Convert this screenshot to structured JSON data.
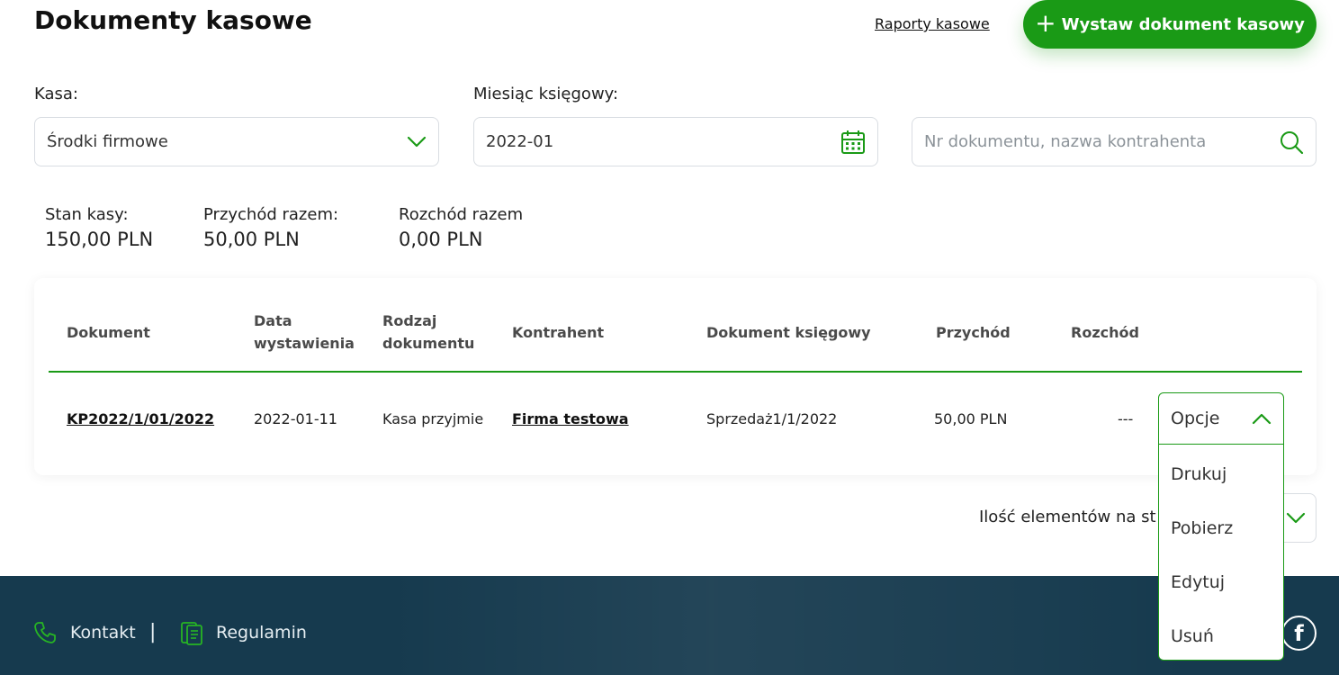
{
  "header": {
    "title": "Dokumenty kasowe",
    "reports_link": "Raporty kasowe",
    "primary_button": "Wystaw dokument kasowy"
  },
  "filters": {
    "kasa": {
      "label": "Kasa:",
      "value": "Środki firmowe"
    },
    "month": {
      "label": "Miesiąc księgowy:",
      "value": "2022-01"
    },
    "search": {
      "placeholder": "Nr dokumentu, nazwa kontrahenta"
    }
  },
  "summary": [
    {
      "label": "Stan kasy:",
      "value": "150,00 PLN"
    },
    {
      "label": "Przychód razem:",
      "value": "50,00 PLN"
    },
    {
      "label": "Rozchód razem",
      "value": "0,00 PLN"
    }
  ],
  "table": {
    "columns": [
      "Dokument",
      "Data wystawienia",
      "Rodzaj dokumentu",
      "Kontrahent",
      "Dokument księgowy",
      "Przychód",
      "Rozchód"
    ],
    "rows": [
      {
        "dokument": "KP2022/1/01/2022",
        "data": "2022-01-11",
        "rodzaj": "Kasa przyjmie",
        "kontrahent": "Firma testowa",
        "dokument_ksiegowy": "Sprzedaż1/1/2022",
        "przychod": "50,00 PLN",
        "rozchod": "---"
      }
    ]
  },
  "options_menu": {
    "label": "Opcje",
    "items": [
      "Drukuj",
      "Pobierz",
      "Edytuj",
      "Usuń"
    ]
  },
  "pagination": {
    "per_page_label": "Ilość elementów na st"
  },
  "footer": {
    "links": [
      "Kontakt",
      "Regulamin"
    ],
    "separator": "|"
  },
  "colors": {
    "accent": "#1a9a16",
    "footer_bg": "#163a4e",
    "border": "#d9dde2"
  },
  "icons": [
    "chevron-down-icon",
    "calendar-icon",
    "search-icon",
    "chevron-up-icon",
    "phone-icon",
    "document-icon",
    "facebook-icon",
    "plus-icon"
  ]
}
